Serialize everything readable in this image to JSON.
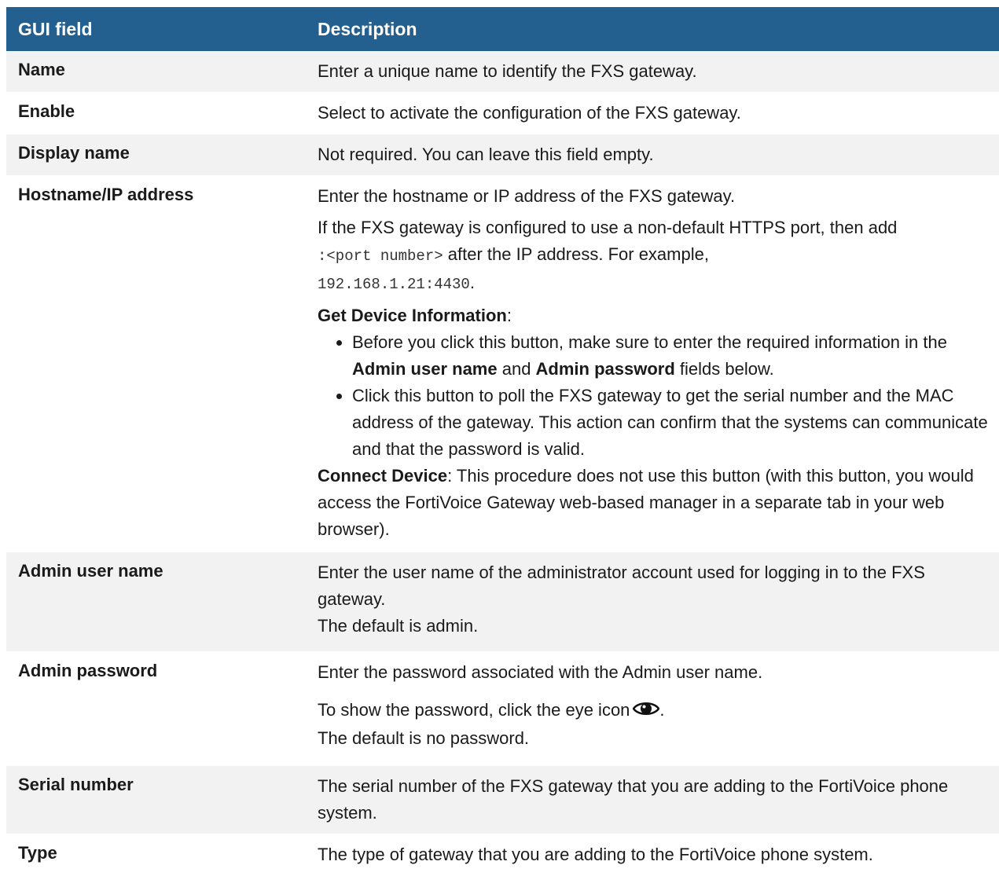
{
  "header": {
    "col1": "GUI field",
    "col2": "Description"
  },
  "rows": [
    {
      "field": "Name",
      "desc": "Enter a unique name to identify the FXS gateway."
    },
    {
      "field": "Enable",
      "desc": "Select to activate the configuration of the FXS gateway."
    },
    {
      "field": "Display name",
      "desc": "Not required. You can leave this field empty."
    },
    {
      "field": "Hostname/IP address",
      "p1": "Enter the hostname or IP address of the FXS gateway.",
      "p2_a": "If the FXS gateway is configured to use a non-default HTTPS port, then add",
      "p2_code1": ":<port number>",
      "p2_b": " after the IP address. For example,",
      "p2_code2": "192.168.1.21:4430",
      "p2_c": ".",
      "gdi_label": "Get Device Information",
      "gdi_colon": ":",
      "b1_a": "Before you click this button, make sure to enter the required information in the ",
      "b1_bold1": "Admin user name",
      "b1_b": " and ",
      "b1_bold2": "Admin password",
      "b1_c": " fields below.",
      "b2": "Click this button to poll the FXS gateway to get the serial number and the MAC address of the gateway. This action can confirm that the systems can communicate and that the password is valid.",
      "cd_label": "Connect Device",
      "cd_text": ": This procedure does not use this button (with this button, you would access the FortiVoice Gateway web-based manager in a separate tab in your web browser)."
    },
    {
      "field": "Admin user name",
      "p1": "Enter the user name of the administrator account used for logging in to the FXS gateway.",
      "p2": "The default is admin."
    },
    {
      "field": "Admin password",
      "p1": "Enter the password associated with the Admin user name.",
      "p2": "To show the password, click the eye icon",
      "p2_end": ".",
      "p3": "The default is no password."
    },
    {
      "field": "Serial number",
      "desc": "The serial number of the FXS gateway that you are adding to the FortiVoice phone system."
    },
    {
      "field": "Type",
      "desc": "The type of gateway that you are adding to the FortiVoice phone system."
    }
  ],
  "colors": {
    "header_bg": "#23608f",
    "row_alt_bg": "#f2f2f2"
  },
  "icons": {
    "eye": "eye-icon"
  }
}
